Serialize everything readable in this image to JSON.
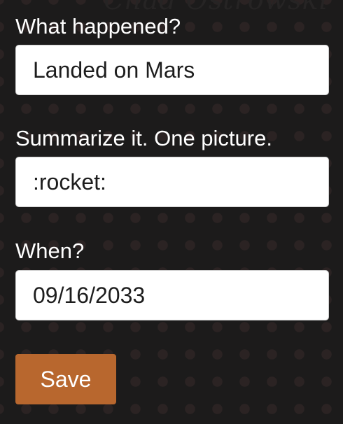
{
  "watermark": "Chad Ostrowski",
  "form": {
    "what_label": "What happened?",
    "what_value": "Landed on Mars",
    "summary_label": "Summarize it. One picture.",
    "summary_value": ":rocket:",
    "when_label": "When?",
    "when_value": "09/16/2033",
    "save_label": "Save"
  },
  "colors": {
    "background": "#1c1b1b",
    "dots": "#2b2323",
    "button": "#b8672e"
  }
}
